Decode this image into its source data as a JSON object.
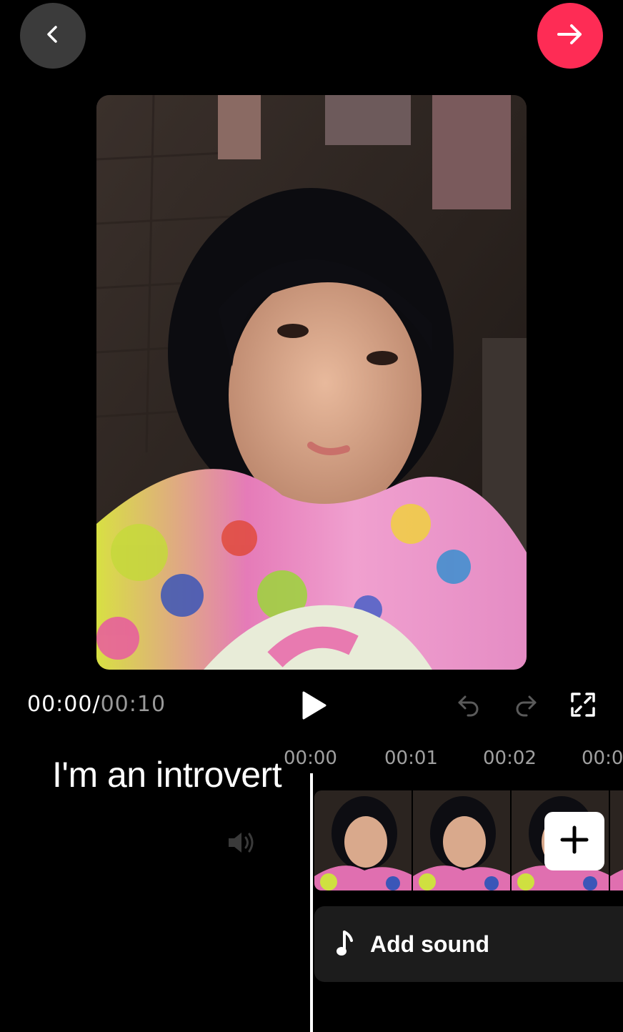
{
  "header": {
    "back_icon": "chevron-left-icon",
    "next_icon": "arrow-right-icon",
    "next_color": "#fe2c55"
  },
  "preview": {
    "description_icon": "video-frame"
  },
  "playback": {
    "current_time": "00:00",
    "separator": "/",
    "total_time": "00:10",
    "play_icon": "play-icon",
    "undo_icon": "undo-icon",
    "redo_icon": "redo-icon",
    "fullscreen_icon": "fullscreen-icon"
  },
  "timeline": {
    "ruler": [
      "00:00",
      "00:01",
      "00:02",
      "00:0"
    ],
    "caption": "I'm an introvert",
    "volume_icon": "volume-icon",
    "add_clip_icon": "plus-icon",
    "add_sound_label": "Add sound",
    "music_icon": "music-note-icon"
  }
}
